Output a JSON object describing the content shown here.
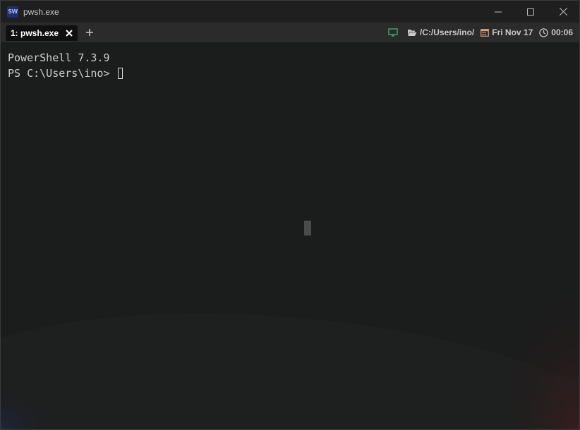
{
  "window": {
    "title": "pwsh.exe",
    "app_icon_text": "SW"
  },
  "tabs": [
    {
      "label": "1: pwsh.exe",
      "active": true
    }
  ],
  "new_tab_label": "+",
  "status_bar": {
    "path": "/C:/Users/ino/",
    "date": "Fri Nov 17",
    "time": "00:06",
    "icons": [
      "monitor-icon",
      "folder-open-icon",
      "calendar-icon",
      "clock-icon"
    ]
  },
  "terminal": {
    "lines": [
      "PowerShell 7.3.9",
      "PS C:\\Users\\ino> "
    ]
  },
  "colors": {
    "titlebar": "#1f1f1f",
    "tabbar": "#2b2b2b",
    "active_tab": "#101010",
    "terminal_bg": "#1b1c1c",
    "terminal_text": "#cccccc",
    "monitor_icon": "#3fa77a",
    "calendar_icon": "#d9a07a"
  }
}
